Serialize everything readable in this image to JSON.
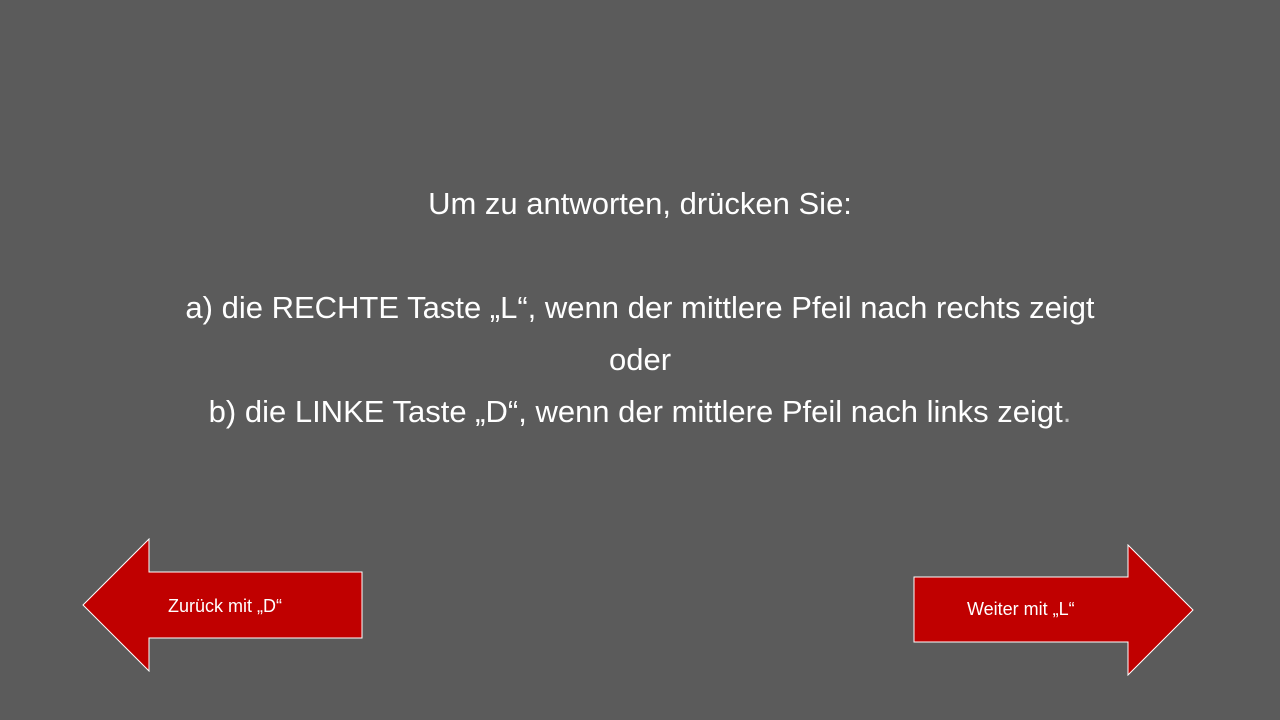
{
  "instructions": {
    "heading": "Um zu antworten, drücken Sie:",
    "option_a": "a) die RECHTE Taste „L“, wenn der mittlere Pfeil nach rechts zeigt",
    "connector": "oder",
    "option_b": "b) die LINKE Taste „D“, wenn der mittlere Pfeil nach links zeigt",
    "option_b_end": "."
  },
  "navigation": {
    "back_label": "Zurück mit „D“",
    "next_label": "Weiter mit „L“"
  },
  "colors": {
    "background": "#5b5b5b",
    "arrow_fill": "#c00000",
    "arrow_border": "#ffffff",
    "text": "#ffffff"
  }
}
